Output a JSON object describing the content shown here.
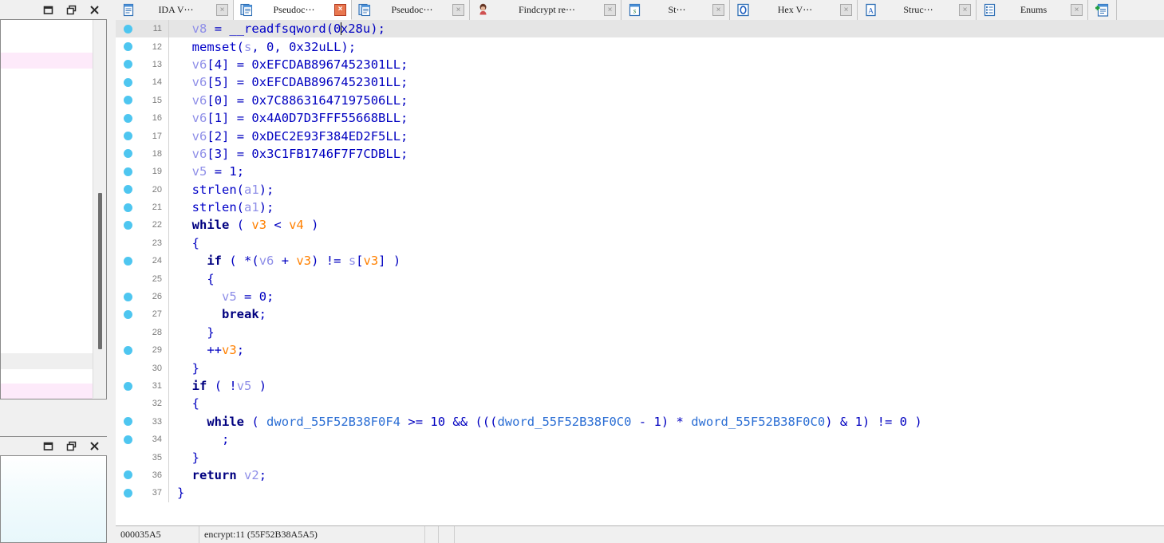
{
  "app": {
    "name": "IDA Pro Pseudocode View"
  },
  "left_windows": [
    {
      "name": "background-window-top",
      "controls": [
        "restore-icon",
        "maximize-icon",
        "close-icon"
      ]
    },
    {
      "name": "background-window-bottom",
      "controls": [
        "restore-icon",
        "maximize-icon",
        "close-icon"
      ]
    }
  ],
  "tabs": [
    {
      "label": "IDA V⋯",
      "icon": "document-view-icon",
      "active": false,
      "close": "×"
    },
    {
      "label": "Pseudoc⋯",
      "icon": "pseudocode-icon",
      "active": true,
      "close": "×"
    },
    {
      "label": "Pseudoc⋯",
      "icon": "pseudocode-icon",
      "active": false,
      "close": "×"
    },
    {
      "label": "Findcrypt re⋯",
      "icon": "findcrypt-icon",
      "active": false,
      "close": "×"
    },
    {
      "label": "St⋯",
      "icon": "strings-icon",
      "active": false,
      "close": "×"
    },
    {
      "label": "Hex V⋯",
      "icon": "hex-view-icon",
      "active": false,
      "close": "×"
    },
    {
      "label": "Struc⋯",
      "icon": "structures-icon",
      "active": false,
      "close": "×"
    },
    {
      "label": "Enums",
      "icon": "enums-icon",
      "active": false,
      "close": "×"
    }
  ],
  "new_tab_button": {
    "icon": "new-tab-icon"
  },
  "code": {
    "language": "c-pseudocode",
    "cursor_line": 11,
    "highlighted_line": 11,
    "lines": [
      {
        "n": "11",
        "bullet": true,
        "text": "  v8 = __readfsqword(0x28u);"
      },
      {
        "n": "12",
        "bullet": true,
        "text": "  memset(s, 0, 0x32uLL);"
      },
      {
        "n": "13",
        "bullet": true,
        "text": "  v6[4] = 0xEFCDAB8967452301LL;"
      },
      {
        "n": "14",
        "bullet": true,
        "text": "  v6[5] = 0xEFCDAB8967452301LL;"
      },
      {
        "n": "15",
        "bullet": true,
        "text": "  v6[0] = 0x7C88631647197506LL;"
      },
      {
        "n": "16",
        "bullet": true,
        "text": "  v6[1] = 0x4A0D7D3FFF55668BLL;"
      },
      {
        "n": "17",
        "bullet": true,
        "text": "  v6[2] = 0xDEC2E93F384ED2F5LL;"
      },
      {
        "n": "18",
        "bullet": true,
        "text": "  v6[3] = 0x3C1FB1746F7F7CDBLL;"
      },
      {
        "n": "19",
        "bullet": true,
        "text": "  v5 = 1;"
      },
      {
        "n": "20",
        "bullet": true,
        "text": "  strlen(a1);"
      },
      {
        "n": "21",
        "bullet": true,
        "text": "  strlen(a1);"
      },
      {
        "n": "22",
        "bullet": true,
        "text": "  while ( v3 < v4 )"
      },
      {
        "n": "23",
        "bullet": false,
        "text": "  {"
      },
      {
        "n": "24",
        "bullet": true,
        "text": "    if ( *(v6 + v3) != s[v3] )"
      },
      {
        "n": "25",
        "bullet": false,
        "text": "    {"
      },
      {
        "n": "26",
        "bullet": true,
        "text": "      v5 = 0;"
      },
      {
        "n": "27",
        "bullet": true,
        "text": "      break;"
      },
      {
        "n": "28",
        "bullet": false,
        "text": "    }"
      },
      {
        "n": "29",
        "bullet": true,
        "text": "    ++v3;"
      },
      {
        "n": "30",
        "bullet": false,
        "text": "  }"
      },
      {
        "n": "31",
        "bullet": true,
        "text": "  if ( !v5 )"
      },
      {
        "n": "32",
        "bullet": false,
        "text": "  {"
      },
      {
        "n": "33",
        "bullet": true,
        "text": "    while ( dword_55F52B38F0F4 >= 10 && (((dword_55F52B38F0C0 - 1) * dword_55F52B38F0C0) & 1) != 0 )"
      },
      {
        "n": "34",
        "bullet": true,
        "text": "      ;"
      },
      {
        "n": "35",
        "bullet": false,
        "text": "  }"
      },
      {
        "n": "36",
        "bullet": true,
        "text": "  return v2;"
      },
      {
        "n": "37",
        "bullet": true,
        "text": "}"
      }
    ]
  },
  "status_bar": {
    "address": "000035A5",
    "function": "encrypt:11 (55F52B38A5A5)",
    "field_a": "",
    "field_b": "",
    "rest": ""
  },
  "colors": {
    "keyword": "#000080",
    "local_var": "#8f8fe8",
    "register_var": "#ff8000",
    "global_symbol": "#2b6ed4",
    "default_code": "#0000c0",
    "line_highlight": "#e5e5e5",
    "bullet": "#4ec6f0",
    "chrome": "#f0f0f0",
    "pink_row": "#fdeafa"
  }
}
